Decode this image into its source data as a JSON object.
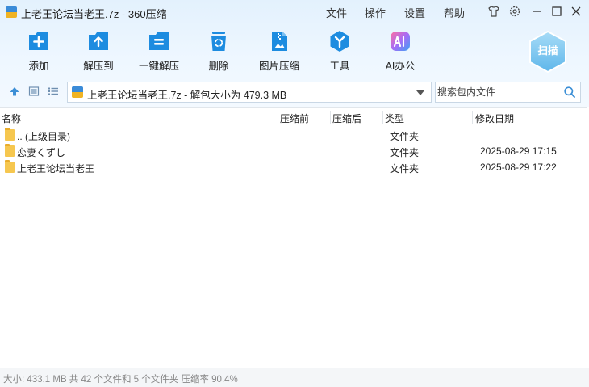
{
  "window": {
    "title": "上老王论坛当老王.7z - 360压缩"
  },
  "menu": [
    "文件",
    "操作",
    "设置",
    "帮助"
  ],
  "toolbar": [
    {
      "label": "添加",
      "icon": "add-icon"
    },
    {
      "label": "解压到",
      "icon": "extract-to-icon"
    },
    {
      "label": "一键解压",
      "icon": "one-click-extract-icon"
    },
    {
      "label": "删除",
      "icon": "delete-icon"
    },
    {
      "label": "图片压缩",
      "icon": "image-compress-icon"
    },
    {
      "label": "工具",
      "icon": "tools-icon"
    },
    {
      "label": "AI办公",
      "icon": "ai-office-icon"
    }
  ],
  "scan_label": "扫描",
  "address": {
    "path": "上老王论坛当老王.7z - 解包大小为 479.3 MB"
  },
  "search": {
    "placeholder": "搜索包内文件"
  },
  "columns": {
    "name": "名称",
    "before": "压缩前",
    "after": "压缩后",
    "type": "类型",
    "modified": "修改日期"
  },
  "rows": [
    {
      "name": ".. (上级目录)",
      "before": "",
      "after": "",
      "type": "文件夹",
      "modified": ""
    },
    {
      "name": "恋妻くずし",
      "before": "",
      "after": "",
      "type": "文件夹",
      "modified": "2025-08-29 17:15"
    },
    {
      "name": "上老王论坛当老王",
      "before": "",
      "after": "",
      "type": "文件夹",
      "modified": "2025-08-29 17:22"
    }
  ],
  "status": "大小: 433.1 MB 共 42 个文件和 5 个文件夹 压缩率 90.4%",
  "colors": {
    "accent": "#1d8ce0",
    "folder": "#f6c74f",
    "header_bg": "#e6f2fd"
  }
}
